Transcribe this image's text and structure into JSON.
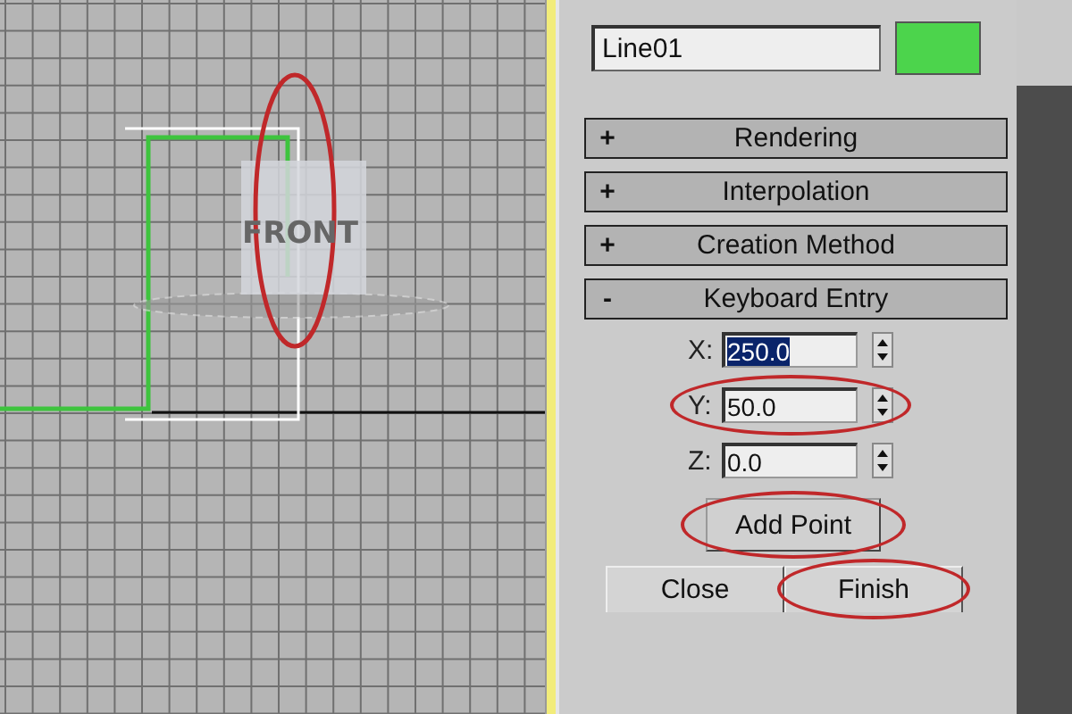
{
  "viewport": {
    "view_label": "FRONT"
  },
  "object": {
    "name": "Line01",
    "color": "#4cd44c"
  },
  "rollouts": [
    {
      "sign": "+",
      "title": "Rendering"
    },
    {
      "sign": "+",
      "title": "Interpolation"
    },
    {
      "sign": "+",
      "title": "Creation Method"
    },
    {
      "sign": "-",
      "title": "Keyboard Entry"
    }
  ],
  "keyboard_entry": {
    "fields": [
      {
        "label": "X:",
        "value": "250.0",
        "highlighted": true
      },
      {
        "label": "Y:",
        "value": "50.0",
        "highlighted": false
      },
      {
        "label": "Z:",
        "value": "0.0",
        "highlighted": false
      }
    ],
    "add_button": "Add Point",
    "buttons": [
      "Close",
      "Finish"
    ]
  }
}
